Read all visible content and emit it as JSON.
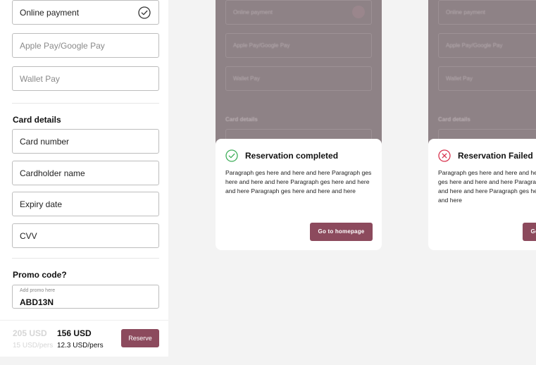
{
  "payment": {
    "options": [
      {
        "label": "Online payment",
        "selected": true
      },
      {
        "label": "Apple Pay/Google Pay",
        "selected": false
      },
      {
        "label": "Wallet Pay",
        "selected": false
      }
    ]
  },
  "card": {
    "title": "Card details",
    "fields": [
      "Card number",
      "Cardholder name",
      "Expiry date",
      "CVV"
    ]
  },
  "promo": {
    "title": "Promo code?",
    "placeholder": "Add promo here",
    "value": "ABD13N"
  },
  "footer": {
    "old_price": "205 USD",
    "old_per": "15 USD/pers",
    "new_price": "156 USD",
    "new_per": "12.3 USD/pers",
    "reserve": "Reserve"
  },
  "modal_success": {
    "title": "Reservation completed",
    "paragraph": "Paragraph ges here and here and here Paragraph ges here and here and here Paragraph ges here and here and here Paragraph ges here and here and here",
    "button": "Go to homepage",
    "background_labels": [
      "Online payment",
      "Apple Pay/Google Pay",
      "Wallet Pay",
      "Card details"
    ]
  },
  "modal_failed": {
    "title": "Reservation Failed",
    "paragraph": "Paragraph ges here and here and here Paragraph ges here and here and here Paragraph ges here and here and here Paragraph ges here and here and here",
    "button": "Go to homepage",
    "background_labels": [
      "Online payment",
      "Apple Pay/Google Pay",
      "Wallet Pay",
      "Card details"
    ]
  },
  "colors": {
    "accent": "#8c4a5d",
    "success": "#3fae5a",
    "error": "#d8344f",
    "overlay": "#8e8286"
  }
}
